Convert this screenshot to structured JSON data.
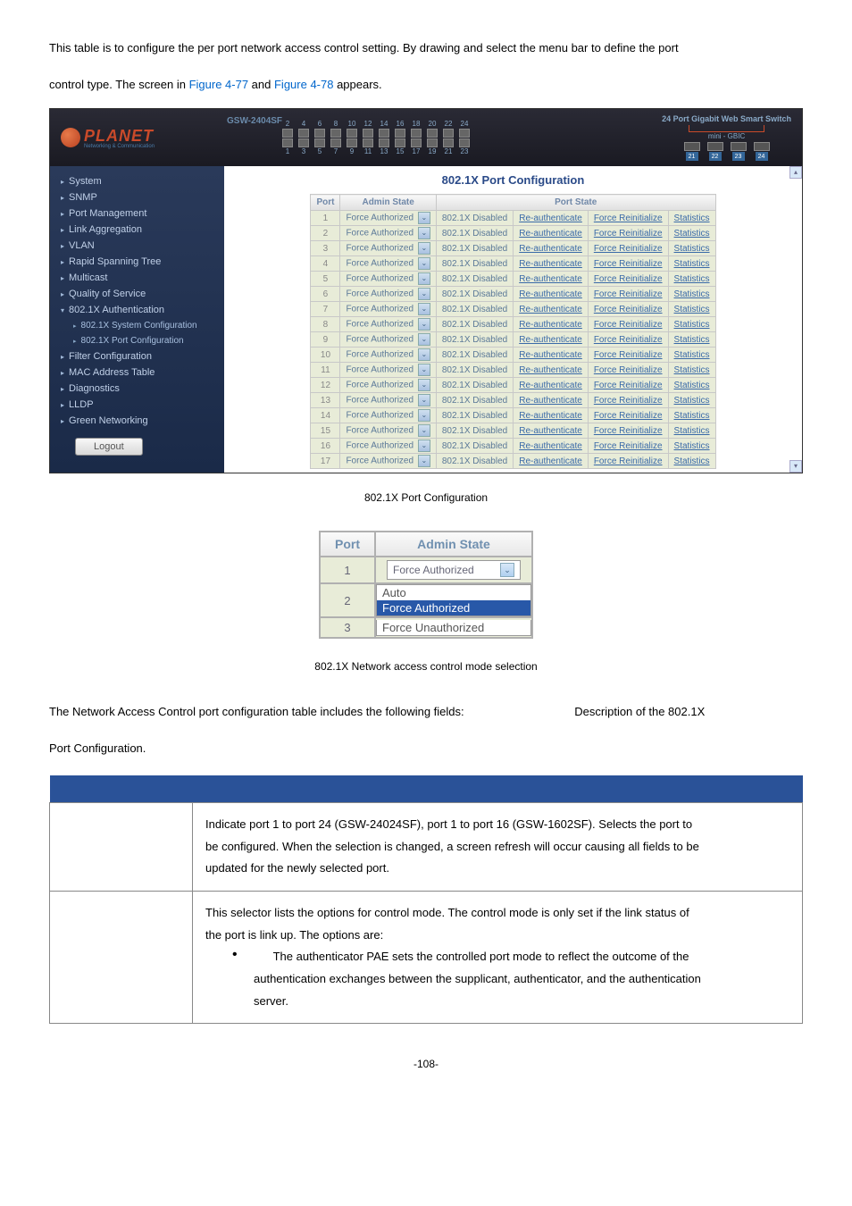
{
  "intro": {
    "p1a": "This table is to configure the per port network access control setting. By drawing and select the menu bar to define the port",
    "p1b": "control type. The screen in ",
    "link1": "Figure 4-77",
    "mid": " and ",
    "link2": "Figure 4-78",
    "end": " appears."
  },
  "brand": {
    "name": "PLANET",
    "sub": "Networking & Communication",
    "model": "GSW-2404SF",
    "gbic_title": "24 Port Gigabit Web Smart Switch",
    "gbic_sub": "mini - GBIC"
  },
  "top_ports": [
    "2",
    "4",
    "6",
    "8",
    "10",
    "12",
    "14",
    "16",
    "18",
    "20",
    "22",
    "24"
  ],
  "bot_ports": [
    "1",
    "3",
    "5",
    "7",
    "9",
    "11",
    "13",
    "15",
    "17",
    "19",
    "21",
    "23"
  ],
  "gbic_nums": [
    "21",
    "22",
    "23",
    "24"
  ],
  "nav": [
    {
      "label": "System",
      "cls": "level1"
    },
    {
      "label": "SNMP",
      "cls": "level1"
    },
    {
      "label": "Port Management",
      "cls": "level1"
    },
    {
      "label": "Link Aggregation",
      "cls": "level1"
    },
    {
      "label": "VLAN",
      "cls": "level1"
    },
    {
      "label": "Rapid Spanning Tree",
      "cls": "level1"
    },
    {
      "label": "Multicast",
      "cls": "level1"
    },
    {
      "label": "Quality of Service",
      "cls": "level1"
    },
    {
      "label": "802.1X Authentication",
      "cls": "level1-open"
    },
    {
      "label": "802.1X System Configuration",
      "cls": "level2"
    },
    {
      "label": "802.1X Port Configuration",
      "cls": "level2"
    },
    {
      "label": "Filter Configuration",
      "cls": "level1"
    },
    {
      "label": "MAC Address Table",
      "cls": "level1"
    },
    {
      "label": "Diagnostics",
      "cls": "level1"
    },
    {
      "label": "LLDP",
      "cls": "level1"
    },
    {
      "label": "Green Networking",
      "cls": "level1"
    }
  ],
  "logout": "Logout",
  "panel": {
    "title": "802.1X Port Configuration"
  },
  "cols": {
    "port": "Port",
    "admin": "Admin State",
    "portstate": "Port State"
  },
  "row": {
    "admin": "Force Authorized",
    "state": "802.1X Disabled",
    "reauth": "Re-authenticate",
    "reinit": "Force Reinitialize",
    "stats": "Statistics"
  },
  "ports": [
    "1",
    "2",
    "3",
    "4",
    "5",
    "6",
    "7",
    "8",
    "9",
    "10",
    "11",
    "12",
    "13",
    "14",
    "15",
    "16",
    "17"
  ],
  "caption1": "802.1X Port Configuration",
  "small": {
    "h_port": "Port",
    "h_admin": "Admin State",
    "r1_port": "1",
    "r1_val": "Force Authorized",
    "r2_port": "2",
    "r2_val": "Auto",
    "r3_port": "3",
    "opt_hl": "Force Authorized",
    "opt_last": "Force Unauthorized"
  },
  "caption2": "802.1X Network access control mode selection",
  "outro": {
    "line1": "The Network Access Control port configuration table includes the following fields:",
    "desc": "Description of the 802.1X",
    "line2": "Port Configuration."
  },
  "tbl": {
    "r1a": "Indicate port 1 to port 24 (GSW-24024SF), port 1 to port 16 (GSW-1602SF). Selects the port to",
    "r1b": "be configured. When the selection is changed, a screen refresh will occur causing all fields to be",
    "r1c": "updated for the newly selected port.",
    "r2a": "This selector lists the options for control mode. The control mode is only set if the link status of",
    "r2b": "the port is link up. The options are:",
    "r2c": "The authenticator PAE sets the controlled port mode to reflect the outcome of the",
    "r2d": "authentication exchanges between the supplicant, authenticator, and the authentication",
    "r2e": "server."
  },
  "pagenum": "-108-"
}
